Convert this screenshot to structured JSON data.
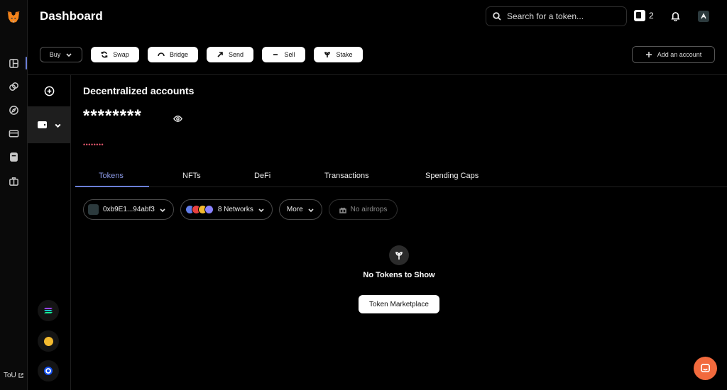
{
  "header": {
    "title": "Dashboard",
    "search_placeholder": "Search for a token...",
    "gas_count": "2"
  },
  "actions": {
    "buy": "Buy",
    "swap": "Swap",
    "bridge": "Bridge",
    "send": "Send",
    "sell": "Sell",
    "stake": "Stake",
    "add_account": "Add an account"
  },
  "account": {
    "section_title": "Decentralized accounts",
    "balance_masked": "********",
    "sub_masked": "••••••••"
  },
  "tabs": [
    {
      "label": "Tokens",
      "active": true
    },
    {
      "label": "NFTs"
    },
    {
      "label": "DeFi"
    },
    {
      "label": "Transactions"
    },
    {
      "label": "Spending Caps"
    }
  ],
  "filters": {
    "address": "0xb9E1...94abf3",
    "networks": "8 Networks",
    "more": "More",
    "airdrops": "No airdrops"
  },
  "empty_state": {
    "message": "No Tokens to Show",
    "button": "Token Marketplace"
  },
  "rail": {
    "tou": "ToU"
  },
  "colors": {
    "accent": "#6b7fd7",
    "masked_text": "#e0566b",
    "chat": "#f26a3d"
  }
}
